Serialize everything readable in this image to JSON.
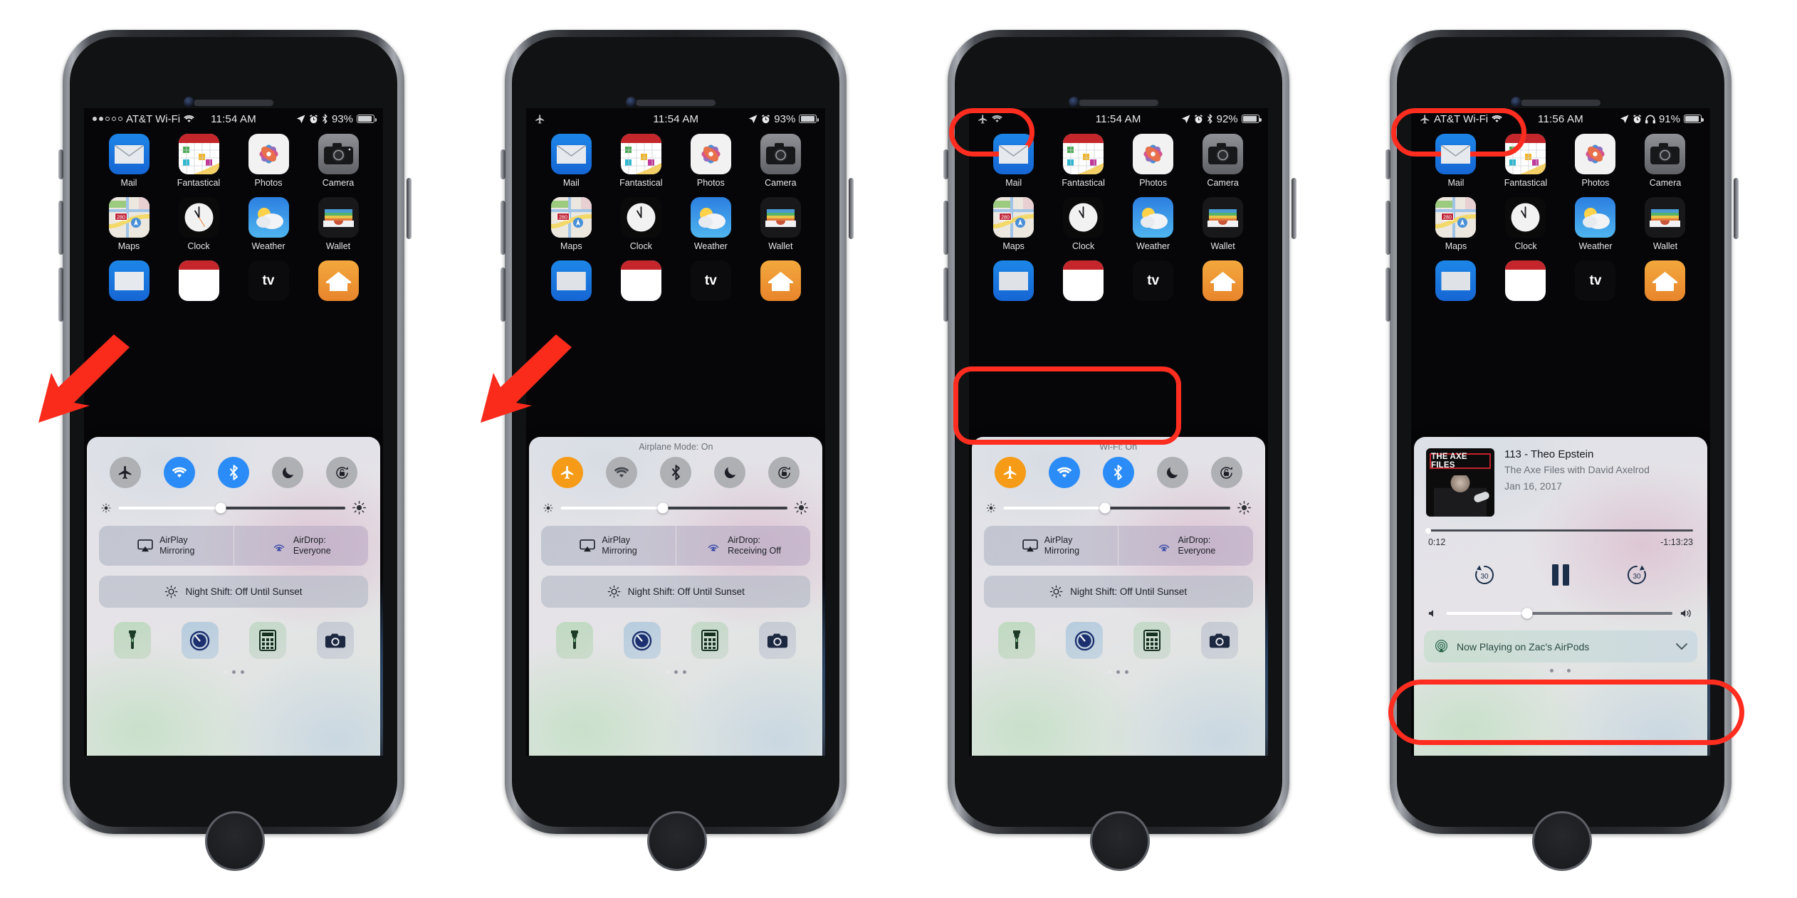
{
  "meta": {
    "accent_red": "#ff2d20",
    "toggle_on_blue": "#2b8cf7",
    "toggle_on_orange": "#f59b17",
    "toggle_off_gray": "#aeb0b4"
  },
  "home_apps": [
    {
      "label": "Mail",
      "icon": "mail-icon"
    },
    {
      "label": "Fantastical",
      "icon": "fantastical-icon"
    },
    {
      "label": "Photos",
      "icon": "photos-icon"
    },
    {
      "label": "Camera",
      "icon": "camera-icon"
    },
    {
      "label": "Maps",
      "icon": "maps-icon"
    },
    {
      "label": "Clock",
      "icon": "clock-icon"
    },
    {
      "label": "Weather",
      "icon": "weather-icon"
    },
    {
      "label": "Wallet",
      "icon": "wallet-icon"
    }
  ],
  "control_center_common": {
    "airplay_label_1": "AirPlay",
    "airplay_label_2": "Mirroring",
    "night_shift": "Night Shift: Off Until Sunset",
    "quick_apps": [
      "flashlight-icon",
      "timer-icon",
      "calculator-icon",
      "camera-icon"
    ]
  },
  "phones": [
    {
      "id": "phone-1",
      "status": {
        "signal_dots_filled": 2,
        "signal_dots_total": 5,
        "carrier": "AT&T Wi-Fi",
        "wifi": true,
        "airplane": false,
        "time": "11:54 AM",
        "location": true,
        "alarm": true,
        "bluetooth": true,
        "headphones": false,
        "battery_pct": "93%",
        "battery_level": 93
      },
      "cc": {
        "hint": "",
        "toggles": [
          {
            "name": "airplane-mode-toggle",
            "state": "off"
          },
          {
            "name": "wifi-toggle",
            "state": "on-blue"
          },
          {
            "name": "bluetooth-toggle",
            "state": "on-blue"
          },
          {
            "name": "do-not-disturb-toggle",
            "state": "off"
          },
          {
            "name": "rotation-lock-toggle",
            "state": "off"
          }
        ],
        "brightness": 45,
        "airdrop_label_1": "AirDrop:",
        "airdrop_label_2": "Everyone"
      },
      "annotations": {
        "arrow": true,
        "highlights": []
      }
    },
    {
      "id": "phone-2",
      "status": {
        "signal_dots_filled": 0,
        "signal_dots_total": 0,
        "carrier": "",
        "wifi": false,
        "airplane": true,
        "time": "11:54 AM",
        "location": true,
        "alarm": true,
        "bluetooth": false,
        "headphones": false,
        "battery_pct": "93%",
        "battery_level": 93
      },
      "cc": {
        "hint": "Airplane Mode: On",
        "toggles": [
          {
            "name": "airplane-mode-toggle",
            "state": "on-orange"
          },
          {
            "name": "wifi-toggle",
            "state": "off"
          },
          {
            "name": "bluetooth-toggle",
            "state": "off"
          },
          {
            "name": "do-not-disturb-toggle",
            "state": "off"
          },
          {
            "name": "rotation-lock-toggle",
            "state": "off"
          }
        ],
        "brightness": 45,
        "airdrop_label_1": "AirDrop:",
        "airdrop_label_2": "Receiving Off"
      },
      "annotations": {
        "arrow": true,
        "highlights": []
      }
    },
    {
      "id": "phone-3",
      "status": {
        "signal_dots_filled": 0,
        "signal_dots_total": 0,
        "carrier": "",
        "wifi": true,
        "airplane": true,
        "time": "11:54 AM",
        "location": true,
        "alarm": true,
        "bluetooth": true,
        "headphones": false,
        "battery_pct": "92%",
        "battery_level": 92
      },
      "cc": {
        "hint": "Wi-Fi: On",
        "toggles": [
          {
            "name": "airplane-mode-toggle",
            "state": "on-orange"
          },
          {
            "name": "wifi-toggle",
            "state": "on-blue"
          },
          {
            "name": "bluetooth-toggle",
            "state": "on-blue"
          },
          {
            "name": "do-not-disturb-toggle",
            "state": "off"
          },
          {
            "name": "rotation-lock-toggle",
            "state": "off"
          }
        ],
        "brightness": 45,
        "airdrop_label_1": "AirDrop:",
        "airdrop_label_2": "Everyone"
      },
      "annotations": {
        "arrow": false,
        "highlights": [
          "status-bar",
          "toggles"
        ]
      }
    },
    {
      "id": "phone-4",
      "status": {
        "signal_dots_filled": 0,
        "signal_dots_total": 0,
        "carrier": "AT&T Wi-Fi",
        "wifi": true,
        "airplane": true,
        "time": "11:56 AM",
        "location": true,
        "alarm": true,
        "bluetooth": false,
        "headphones": true,
        "battery_pct": "91%",
        "battery_level": 91
      },
      "now_playing": {
        "artwork_text": "THE AXE FILES",
        "title": "113 - Theo Epstein",
        "subtitle": "The Axe Files with David Axelrod",
        "date": "Jan 16, 2017",
        "elapsed": "0:12",
        "remaining": "-1:13:23",
        "progress_pct": 0.3,
        "skip_back_label": "30",
        "skip_forward_label": "30",
        "playback_state": "playing",
        "volume_pct": 36,
        "airplay_route": "Now Playing on Zac's AirPods"
      },
      "annotations": {
        "arrow": false,
        "highlights": [
          "status-bar",
          "airplay-route"
        ]
      }
    }
  ]
}
